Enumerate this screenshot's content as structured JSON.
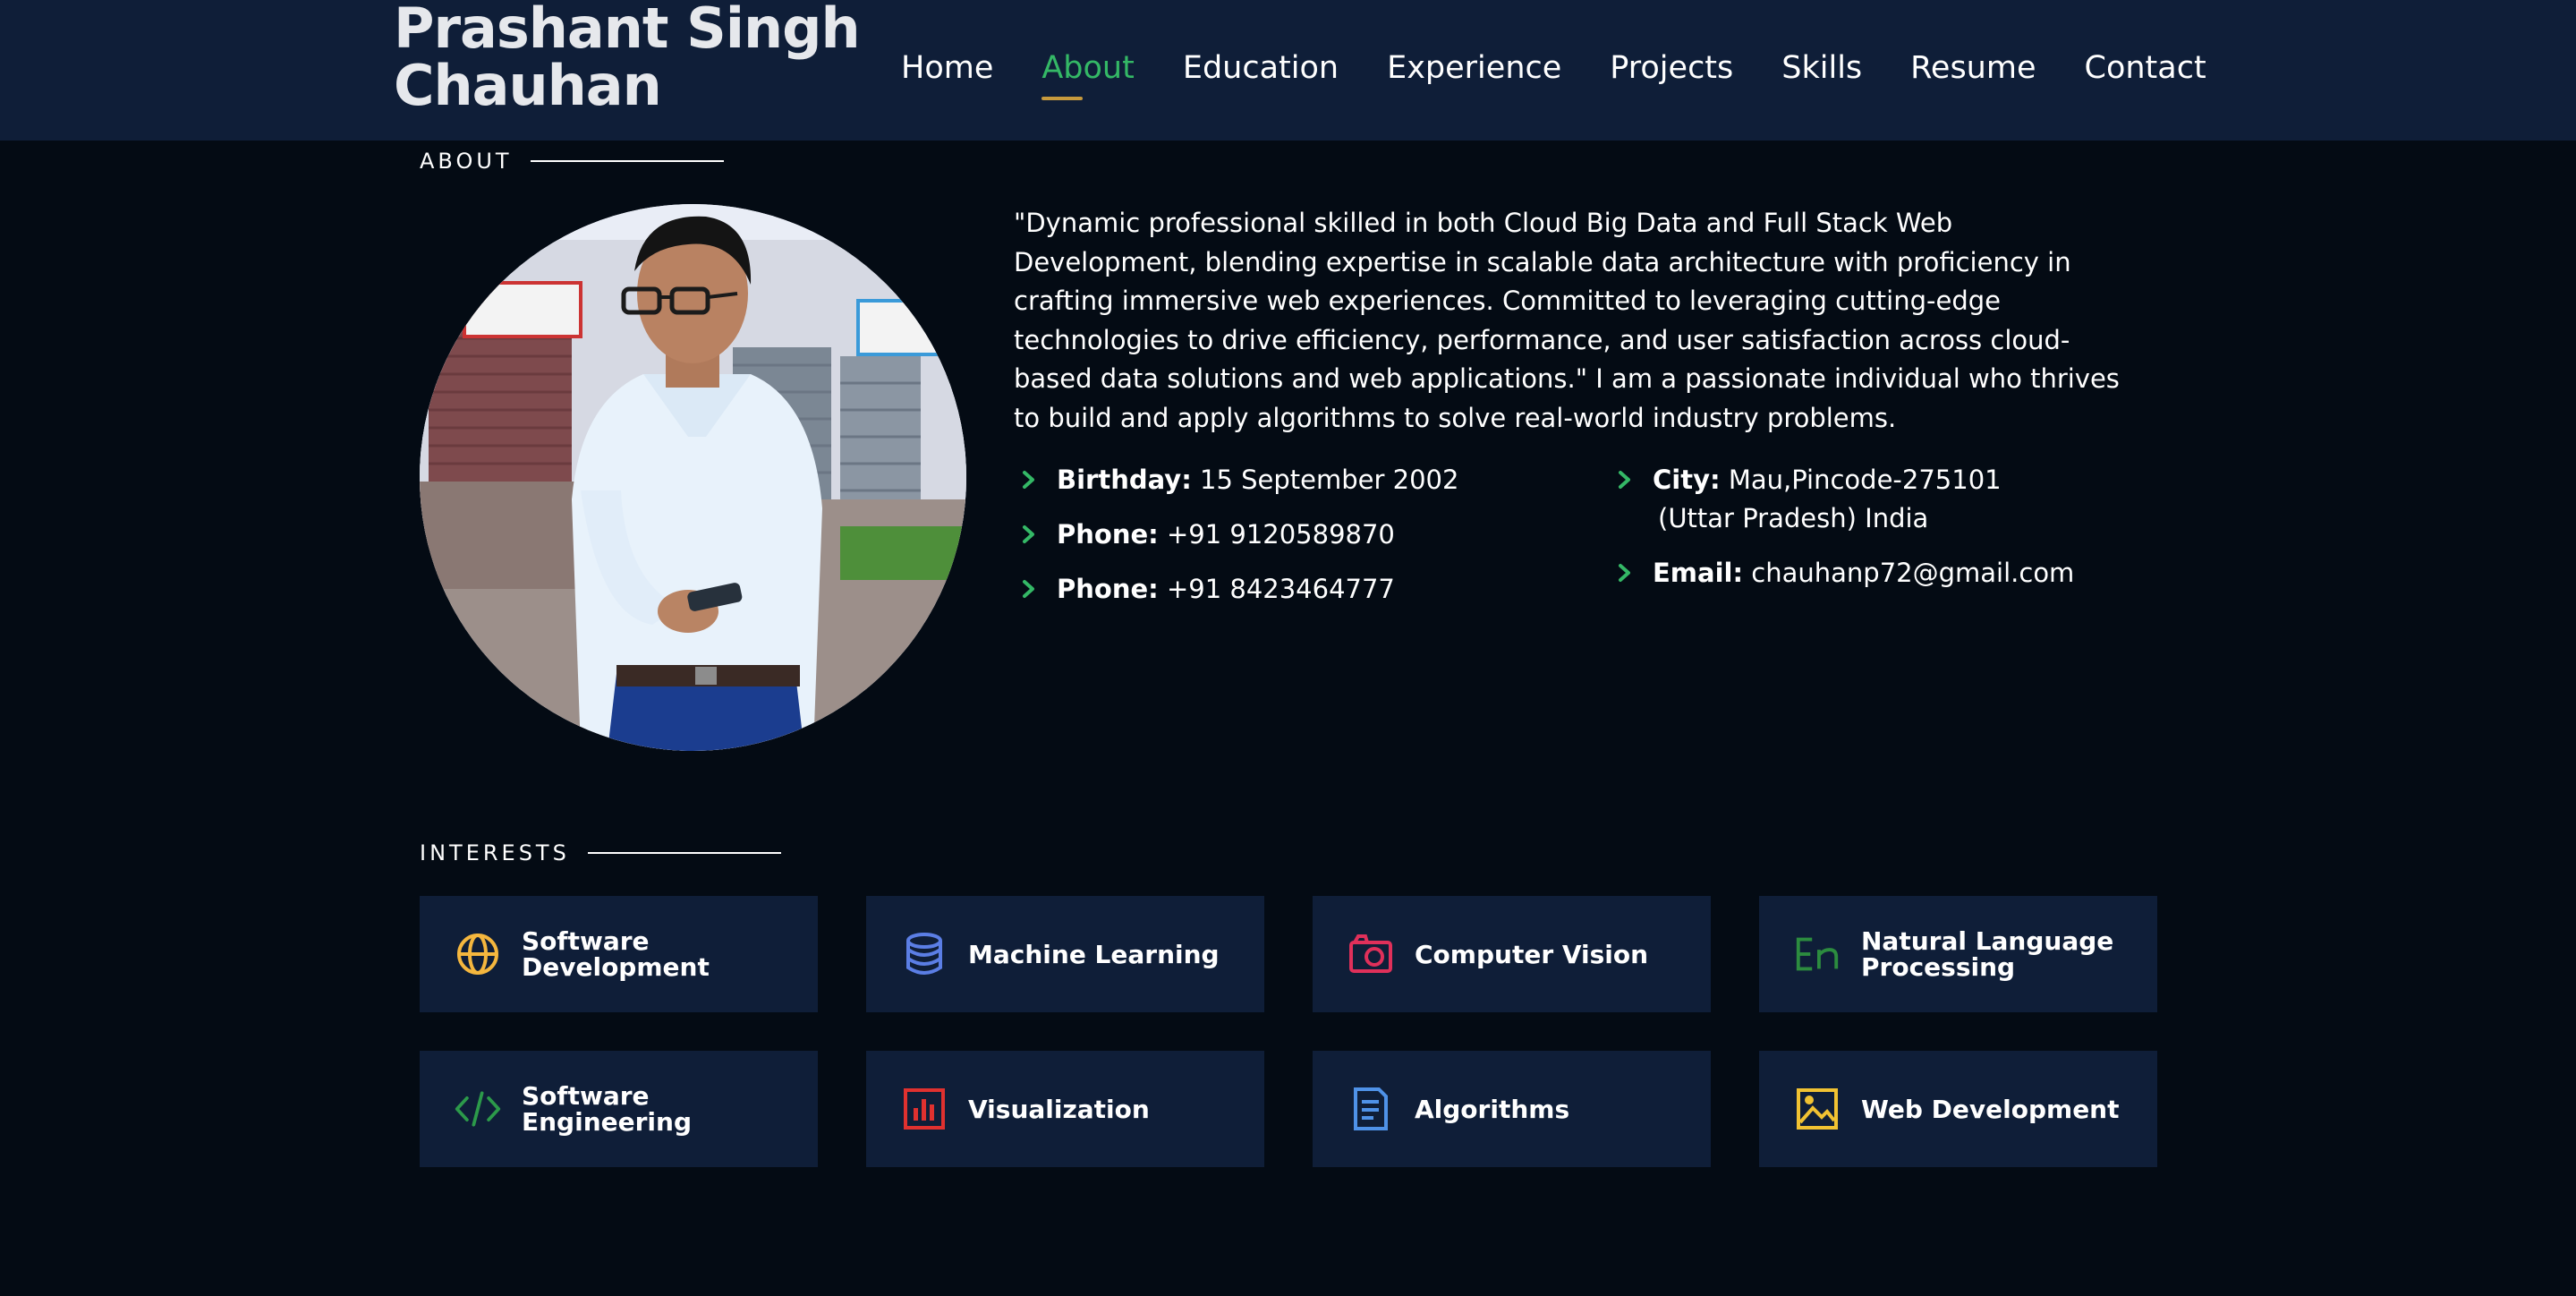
{
  "header": {
    "logo_line1": "Prashant Singh",
    "logo_line2": "Chauhan",
    "nav": [
      "Home",
      "About",
      "Education",
      "Experience",
      "Projects",
      "Skills",
      "Resume",
      "Contact"
    ],
    "active_nav": "About"
  },
  "about": {
    "section_title": "ABOUT",
    "bio": "\"Dynamic professional skilled in both Cloud Big Data and Full Stack Web Development, blending expertise in scalable data architecture with proficiency in crafting immersive web experiences. Committed to leveraging cutting-edge technologies to drive efficiency, performance, and user satisfaction across cloud-based data solutions and web applications.\" I am a passionate individual who thrives to build and apply algorithms to solve real-world industry problems.",
    "left_info": [
      {
        "label": "Birthday:",
        "value": "15 September 2002"
      },
      {
        "label": "Phone:",
        "value": "+91 9120589870"
      },
      {
        "label": "Phone:",
        "value": "+91 8423464777"
      }
    ],
    "city_label": "City:",
    "city_value": "Mau,Pincode-275101",
    "city_value2": "(Uttar Pradesh) India",
    "email_label": "Email:",
    "email_value": "chauhanp72@gmail.com"
  },
  "interests": {
    "section_title": "INTERESTS",
    "items": [
      {
        "label": "Software Development",
        "icon": "globe-icon",
        "color": "#f5b73e"
      },
      {
        "label": "Machine Learning",
        "icon": "database-icon",
        "color": "#5b7ee5"
      },
      {
        "label": "Computer Vision",
        "icon": "camera-icon",
        "color": "#e0305a"
      },
      {
        "label": "Natural Language Processing",
        "icon": "language-en-icon",
        "color": "#2c8c3f"
      },
      {
        "label": "Software Engineering",
        "icon": "code-icon",
        "color": "#2c9a4a"
      },
      {
        "label": "Visualization",
        "icon": "bar-chart-icon",
        "color": "#e0312f"
      },
      {
        "label": "Algorithms",
        "icon": "document-icon",
        "color": "#4f92e8"
      },
      {
        "label": "Web Development",
        "icon": "image-icon",
        "color": "#f1c232"
      }
    ]
  },
  "colors": {
    "header_bg": "#0f1e38",
    "page_bg": "#040b14",
    "card_bg": "#0f1e38",
    "active_nav": "#34b866",
    "nav_underline": "#c79a3d",
    "chevron": "#34b866"
  }
}
